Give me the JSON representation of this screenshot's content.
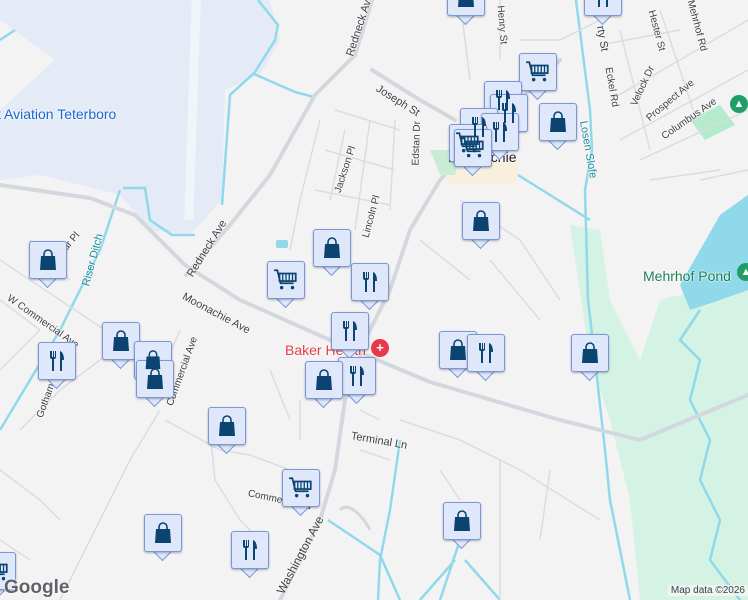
{
  "map": {
    "places": {
      "airport": "t Aviation Teterboro",
      "town": "Moonachie",
      "pond": "Mehrhof Pond",
      "hospital": "Baker Health"
    },
    "streets": {
      "redneck_top": "Redneck Ave",
      "redneck_bottom": "Redneck Ave",
      "joseph": "Joseph St",
      "jackson": "Jackson Pl",
      "lincoln": "Lincoln Pl",
      "edstan": "Edstan Dr",
      "henry": "Henry St",
      "hester": "Hester St",
      "mehrhof_rd": "Mehrhof Rd",
      "eckel": "Eckel Rd",
      "velock": "Velock Dr",
      "prospect": "Prospect Ave",
      "columbus": "Columbus Ave",
      "liberty": "rty St",
      "moonachie_ave": "Moonachie Ave",
      "w_commercial": "W Commercial Ave",
      "commercial": "Commercial Ave",
      "gotham": "Gotham Pkwy",
      "caesar": "esar Pl",
      "terminal": "Terminal Ln",
      "commerce": "Commerce Rd",
      "washington": "Washington Ave"
    },
    "waterways": {
      "riser": "Riser Ditch",
      "losen": "Losen Slofe"
    },
    "marker_types": [
      "shopping-bag",
      "shopping-cart",
      "restaurant"
    ],
    "colors": {
      "land": "#f4f3f4",
      "water": "#8fd9ea",
      "airport": "#e5ebf6",
      "park": "#d4f3e4",
      "road": "#d3d8de",
      "marker_fill": "#dfe8fb",
      "marker_icon": "#0b4470",
      "hospital": "#e8394a"
    }
  },
  "footer": {
    "google": "Google",
    "attribution": "Map data ©2026"
  }
}
